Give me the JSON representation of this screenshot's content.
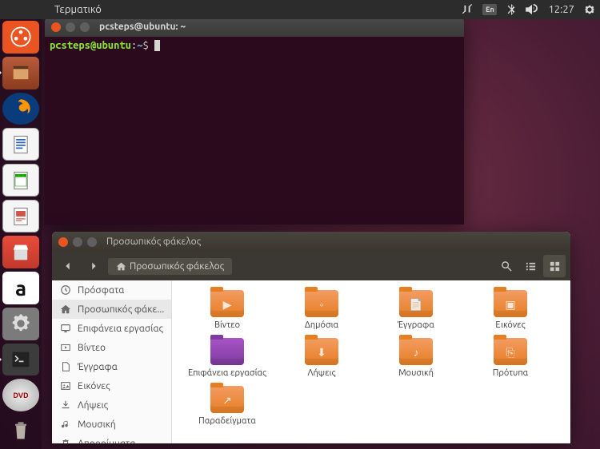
{
  "menubar": {
    "title": "Τερματικό",
    "lang": "En",
    "time": "12:27"
  },
  "launcher": [
    {
      "name": "dash",
      "label": "Dash"
    },
    {
      "name": "files",
      "label": "Files"
    },
    {
      "name": "firefox",
      "label": "Firefox"
    },
    {
      "name": "writer",
      "label": "LibreOffice Writer"
    },
    {
      "name": "calc",
      "label": "LibreOffice Calc"
    },
    {
      "name": "impress",
      "label": "LibreOffice Impress"
    },
    {
      "name": "software",
      "label": "Ubuntu Software"
    },
    {
      "name": "amazon",
      "label": "Amazon"
    },
    {
      "name": "settings",
      "label": "System Settings"
    },
    {
      "name": "terminal",
      "label": "Terminal"
    },
    {
      "name": "dvd",
      "label": "DVD"
    },
    {
      "name": "trash",
      "label": "Trash"
    }
  ],
  "terminal": {
    "title": "pcsteps@ubuntu: ~",
    "prompt_user": "pcsteps@ubuntu",
    "prompt_colon": ":",
    "prompt_path": "~",
    "prompt_dollar": "$"
  },
  "files": {
    "title": "Προσωπικός φάκελος",
    "path_label": "Προσωπικός φάκελος",
    "sidebar": [
      {
        "icon": "clock",
        "label": "Πρόσφατα"
      },
      {
        "icon": "home",
        "label": "Προσωπικός φάκε...",
        "selected": true
      },
      {
        "icon": "desktop",
        "label": "Επιφάνεια εργασίας"
      },
      {
        "icon": "video",
        "label": "Βίντεο"
      },
      {
        "icon": "doc",
        "label": "Έγγραφα"
      },
      {
        "icon": "image",
        "label": "Εικόνες"
      },
      {
        "icon": "download",
        "label": "Λήψεις"
      },
      {
        "icon": "music",
        "label": "Μουσική"
      },
      {
        "icon": "trash",
        "label": "Απορρίμματα"
      }
    ],
    "items": [
      {
        "label": "Βίντεο",
        "inner": "video"
      },
      {
        "label": "Δημόσια",
        "inner": "public"
      },
      {
        "label": "Έγγραφα",
        "inner": "doc"
      },
      {
        "label": "Εικόνες",
        "inner": "image"
      },
      {
        "label": "Επιφάνεια εργασίας",
        "inner": "desktop",
        "purple": true
      },
      {
        "label": "Λήψεις",
        "inner": "download"
      },
      {
        "label": "Μουσική",
        "inner": "music"
      },
      {
        "label": "Πρότυπα",
        "inner": "template"
      },
      {
        "label": "Παραδείγματα",
        "inner": "link"
      }
    ]
  }
}
